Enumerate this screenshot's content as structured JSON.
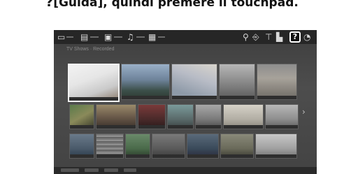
{
  "caption": {
    "icon": "?",
    "text": "[Guida], quindi premere il touchpad."
  },
  "tv": {
    "topbar": {
      "icons": [
        "tv-input-icon",
        "film-icon",
        "photo-icon",
        "music-icon",
        "apps-icon"
      ],
      "right_icons": [
        "search-icon",
        "input-icon",
        "network-icon",
        "settings-icon"
      ],
      "help_label": "?"
    },
    "breadcrumb": "TV Shows · Recorded",
    "colors": {
      "background": "#474747",
      "topbar": "#262626",
      "selection": "#f2f2f2"
    }
  }
}
